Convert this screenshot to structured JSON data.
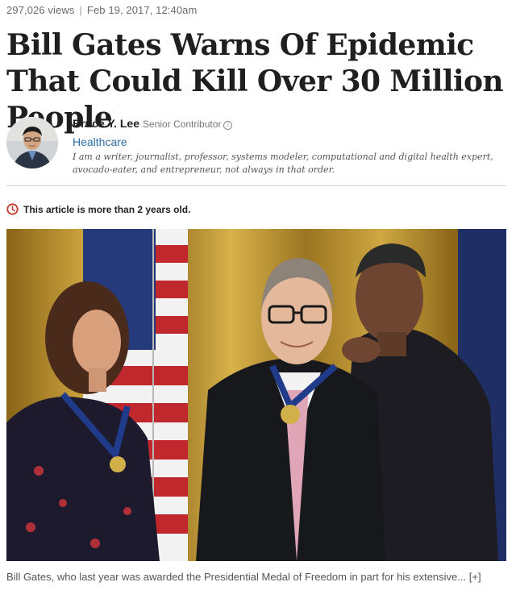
{
  "article": {
    "views": "297,026 views",
    "separator": "|",
    "date": "Feb 19, 2017, 12:40am",
    "headline": "Bill Gates Warns Of Epidemic That Could Kill Over 30 Million People"
  },
  "author": {
    "name": "Bruce Y. Lee",
    "role": "Senior Contributor",
    "info_glyph": "i",
    "category": "Healthcare",
    "bio": "I am a writer, journalist, professor, systems modeler, computational and digital health expert, avocado-eater, and entrepreneur, not always in that order."
  },
  "notice": {
    "text": "This article is more than 2 years old.",
    "icon": "clock-icon",
    "color": "#c0392b"
  },
  "photo": {
    "icon": "photo"
  },
  "caption": {
    "text": "Bill Gates, who last year was awarded the Presidential Medal of Freedom in part for his extensive...",
    "more": "[+]"
  },
  "colors": {
    "link": "#2c6fa8",
    "headline": "#1f1f1f",
    "meta": "#6a6a6a"
  }
}
